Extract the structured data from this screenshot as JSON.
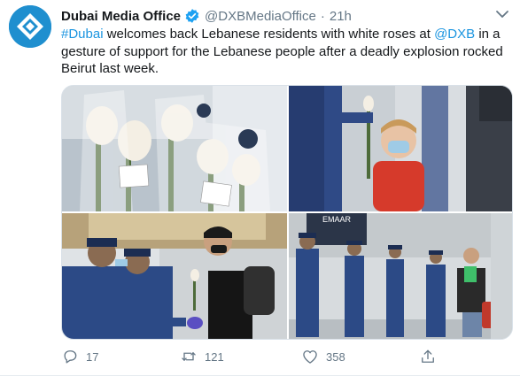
{
  "tweet": {
    "author_name": "Dubai Media Office",
    "handle": "@DXBMediaOffice",
    "separator": "·",
    "time": "21h",
    "text_parts": {
      "hashtag": "#Dubai",
      "part1": " welcomes back Lebanese residents with white roses at ",
      "mention": "@DXB",
      "part2": " in a gesture of support for the Lebanese people after a deadly explosion rocked Beirut last week."
    },
    "photo_signage": "EMAAR",
    "actions": {
      "replies": "17",
      "retweets": "121",
      "likes": "358"
    }
  },
  "colors": {
    "link": "#1b95e0",
    "secondary_text": "#657786",
    "verified_badge": "#1da1f2",
    "avatar_bg": "#1f8fcf"
  },
  "icons": [
    "dubai-media-office-logo-icon",
    "verified-badge-icon",
    "chevron-down-icon",
    "reply-icon",
    "retweet-icon",
    "like-icon",
    "share-icon"
  ]
}
